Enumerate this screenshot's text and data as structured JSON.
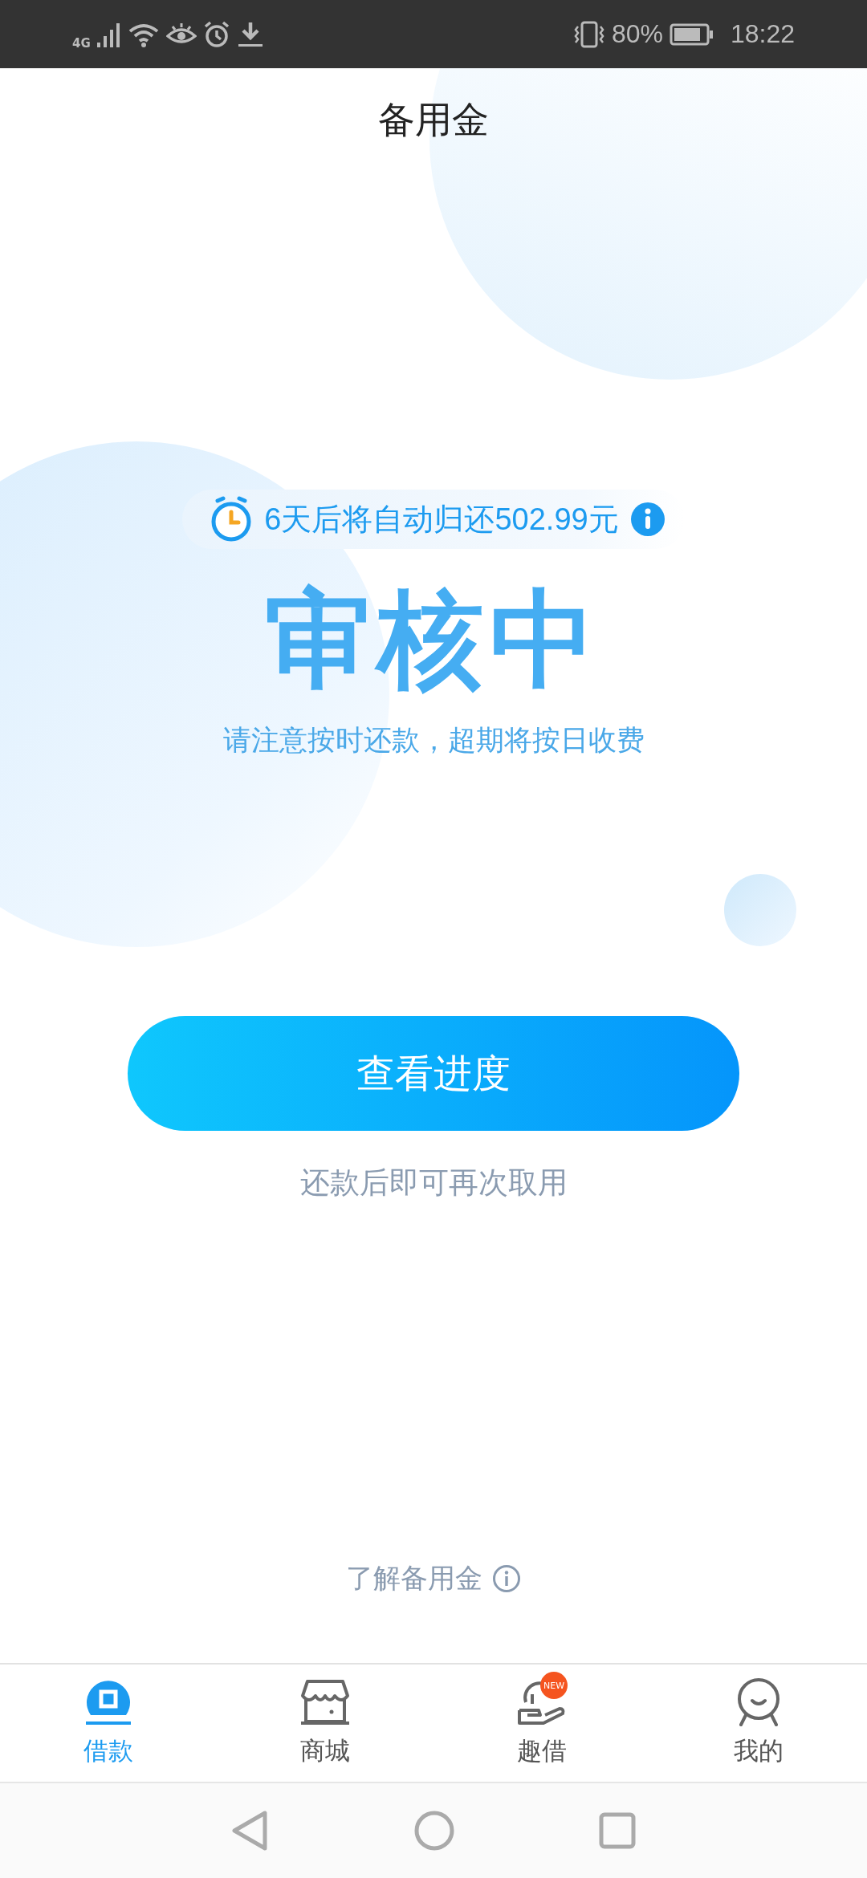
{
  "status_bar": {
    "network": "4G",
    "battery": "80%",
    "time": "18:22"
  },
  "header": {
    "title": "备用金"
  },
  "notice": {
    "text": "6天后将自动归还502.99元"
  },
  "status": {
    "title": "审核中",
    "subtitle": "请注意按时还款，超期将按日收费"
  },
  "primary_button": {
    "label": "查看进度"
  },
  "hint": "还款后即可再次取用",
  "learn_more": {
    "label": "了解备用金"
  },
  "tabs": [
    {
      "label": "借款",
      "selected": true,
      "kind": "loan"
    },
    {
      "label": "商城",
      "selected": false,
      "kind": "shop"
    },
    {
      "label": "趣借",
      "selected": false,
      "kind": "hand",
      "badge": "NEW"
    },
    {
      "label": "我的",
      "selected": false,
      "kind": "profile"
    }
  ]
}
